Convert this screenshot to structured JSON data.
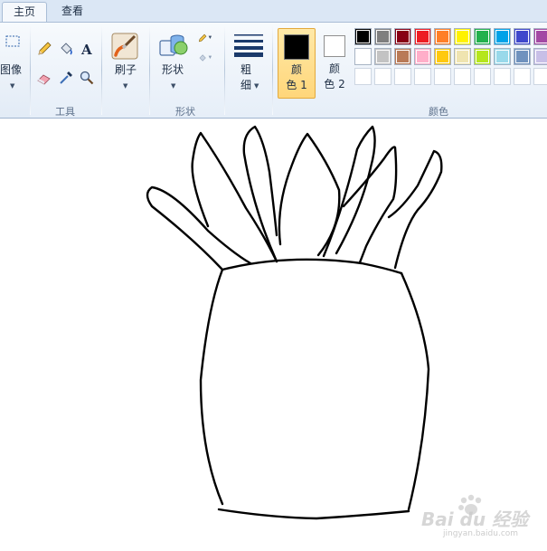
{
  "tabs": [
    {
      "label": "主页",
      "active": true
    },
    {
      "label": "查看",
      "active": false
    }
  ],
  "ribbon": {
    "image_group": {
      "label": "图像"
    },
    "tools_group": {
      "label": "工具",
      "tools": [
        "pencil-icon",
        "fill-bucket-icon",
        "text-icon",
        "eraser-icon",
        "color-picker-icon",
        "magnifier-icon"
      ]
    },
    "brush": {
      "label": "刷子"
    },
    "shapes_group": {
      "label": "形状",
      "button_label": "形状"
    },
    "size": {
      "label_line1": "粗",
      "label_line2": "细"
    },
    "color1": {
      "label_line1": "颜",
      "label_line2": "色 1",
      "color": "#000000"
    },
    "color2": {
      "label_line1": "颜",
      "label_line2": "色 2",
      "color": "#ffffff"
    },
    "colors_group": {
      "label": "颜色"
    }
  },
  "palette": {
    "row1": [
      "#000000",
      "#7f7f7f",
      "#880015",
      "#ed1c24",
      "#ff7f27",
      "#fff200",
      "#22b14c",
      "#00a2e8",
      "#3f48cc",
      "#a349a4"
    ],
    "row2": [
      "#ffffff",
      "#c3c3c3",
      "#b97a57",
      "#ffaec9",
      "#ffc90e",
      "#efe4b0",
      "#b5e61d",
      "#99d9ea",
      "#7092be",
      "#c8bfe7"
    ],
    "row3": [
      "#ffffff",
      "#ffffff",
      "#ffffff",
      "#ffffff",
      "#ffffff",
      "#ffffff",
      "#ffffff",
      "#ffffff",
      "#ffffff",
      "#ffffff"
    ]
  },
  "accent": {
    "selected_color_button": "#ffd67a",
    "ribbon_border": "#a9bdd6"
  },
  "watermark": {
    "text": "Bai du 经验",
    "sub": "jingyan.baidu.com"
  }
}
